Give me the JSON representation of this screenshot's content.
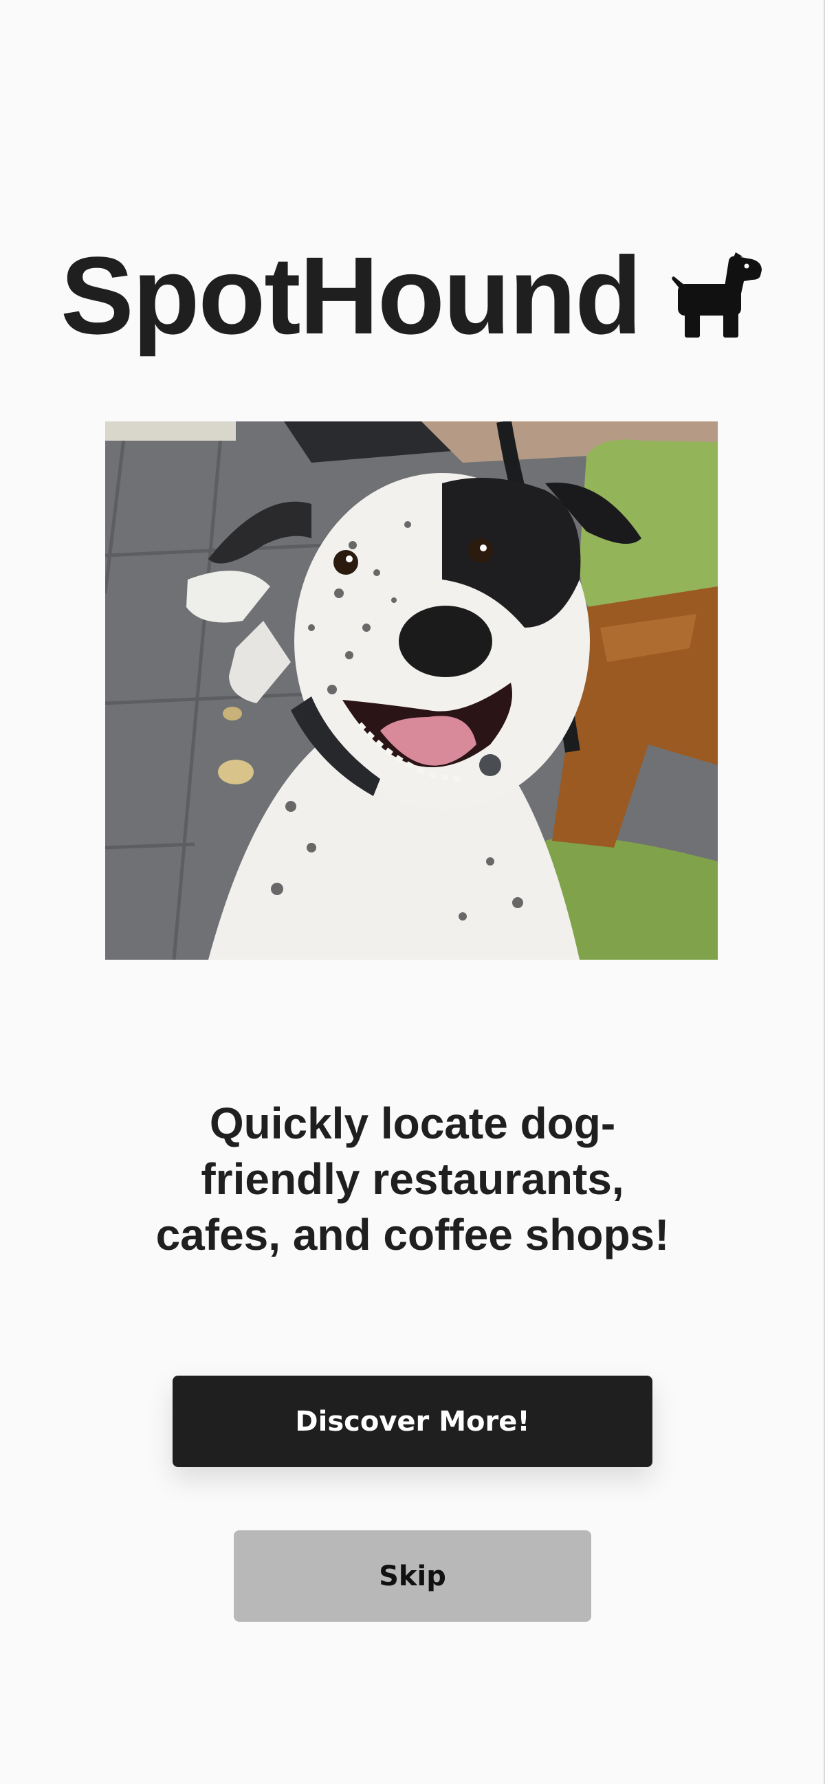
{
  "app": {
    "name": "SpotHound",
    "logo_icon": "dog-icon"
  },
  "hero": {
    "image": "dog-photo"
  },
  "onboarding": {
    "tagline": "Quickly locate dog-friendly restaurants, cafes, and coffee shops!"
  },
  "actions": {
    "primary_label": "Discover More!",
    "secondary_label": "Skip"
  },
  "colors": {
    "background": "#fafafa",
    "text": "#1f1f1f",
    "primary_button": "#1f1f1f",
    "secondary_button": "#b8b8b8"
  }
}
